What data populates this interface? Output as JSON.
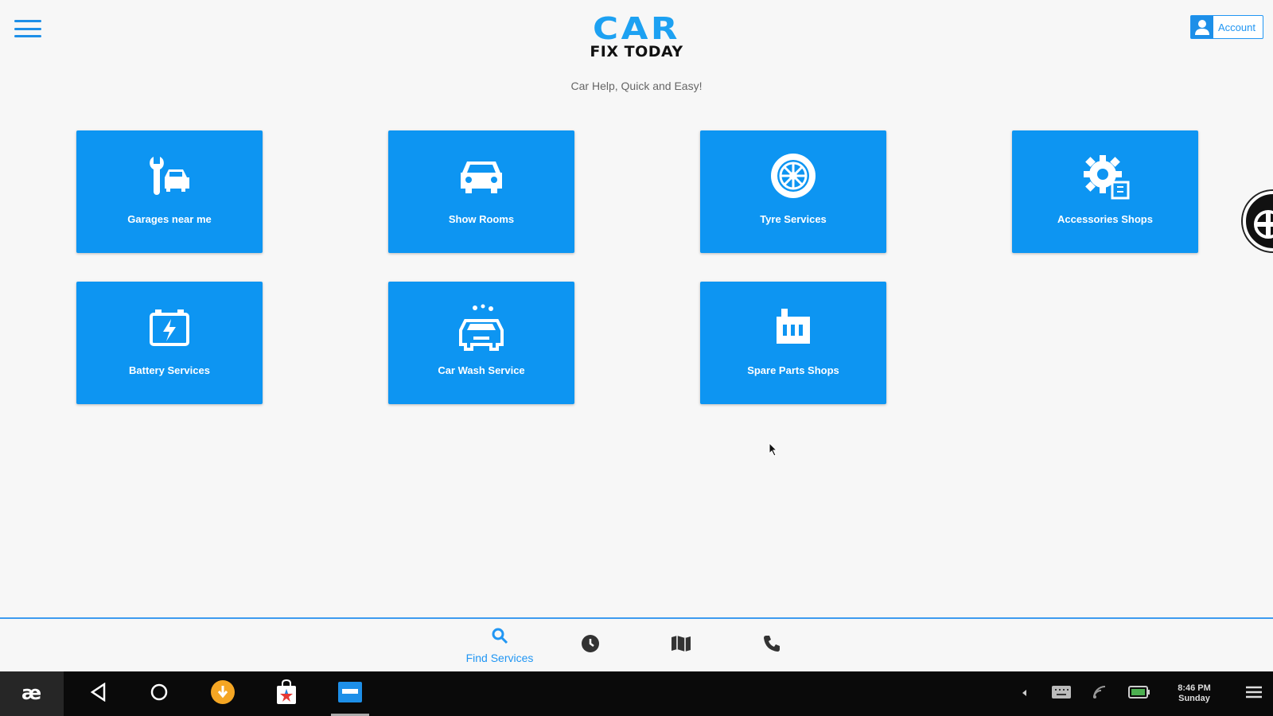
{
  "header": {
    "logo_top": "CAR",
    "logo_bottom": "FIX TODAY",
    "tagline": "Car Help, Quick and Easy!",
    "account_label": "Account"
  },
  "tiles": [
    {
      "label": "Garages near me",
      "icon": "wrench-car-icon"
    },
    {
      "label": "Show Rooms",
      "icon": "car-front-icon"
    },
    {
      "label": "Tyre Services",
      "icon": "tyre-icon"
    },
    {
      "label": "Accessories Shops",
      "icon": "gear-icon"
    },
    {
      "label": "Battery Services",
      "icon": "battery-icon"
    },
    {
      "label": "Car Wash Service",
      "icon": "car-wash-icon"
    },
    {
      "label": "Spare Parts Shops",
      "icon": "spare-parts-icon"
    }
  ],
  "bottom_nav": {
    "items": [
      {
        "label": "Find Services",
        "icon": "search-icon",
        "active": true
      },
      {
        "label": "",
        "icon": "history-icon"
      },
      {
        "label": "",
        "icon": "map-icon"
      },
      {
        "label": "",
        "icon": "phone-icon"
      }
    ]
  },
  "taskbar": {
    "time": "8:46 PM",
    "day": "Sunday",
    "apps": [
      "start-icon",
      "back-icon",
      "home-icon",
      "download-app-icon",
      "store-app-icon",
      "car-fix-app-icon"
    ]
  },
  "colors": {
    "accent": "#0d95f2",
    "brand": "#1da1f2",
    "background": "#f7f7f7",
    "taskbar": "#0a0a0a"
  }
}
